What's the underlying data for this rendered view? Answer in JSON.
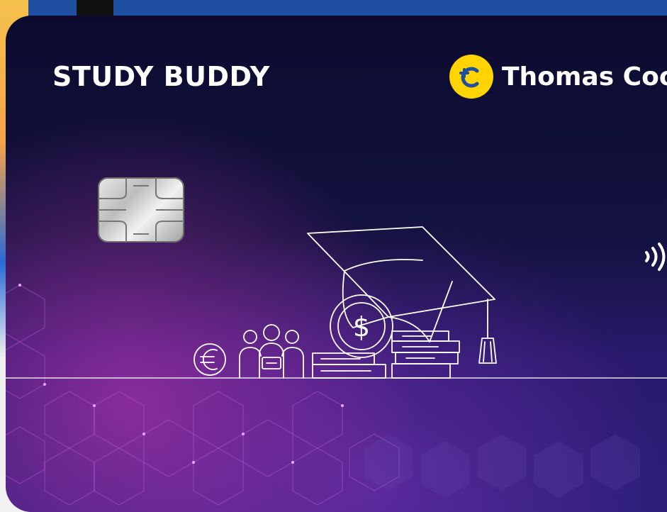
{
  "card": {
    "product_name": "STUDY BUDDY",
    "issuer_name": "Thomas Coo"
  },
  "colors": {
    "card_dark": "#0c0b2e",
    "card_purple": "#2c1f7a",
    "glow_magenta": "#d63abe",
    "issuer_yellow": "#ffd400",
    "issuer_blue": "#1f4fa0"
  },
  "icons": [
    "thomas-cook-logo-icon",
    "emv-chip-icon",
    "contactless-icon",
    "graduation-cap-icon",
    "dollar-coin-icon",
    "euro-icon",
    "students-group-icon",
    "book-stack-icon",
    "hexagon-pattern"
  ]
}
